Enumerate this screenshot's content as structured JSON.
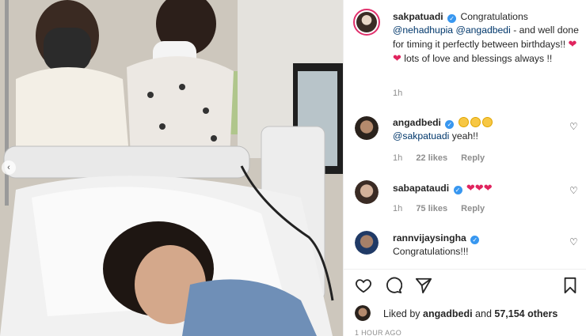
{
  "post": {
    "author": "sakpatuadi",
    "caption_parts": {
      "before": "Congratulations",
      "mention1": "@nehadhupia",
      "mention2": "@angadbedi",
      "after": "- and well done for timing it perfectly between birthdays!!",
      "end": "lots of love and blessings always !!"
    },
    "caption_time": "1h"
  },
  "comments": [
    {
      "user": "angadbedi",
      "mention": "@sakpatuadi",
      "text": "yeah!!",
      "time": "1h",
      "likes": "22 likes",
      "reply": "Reply"
    },
    {
      "user": "sabapataudi",
      "time": "1h",
      "likes": "75 likes",
      "reply": "Reply"
    },
    {
      "user": "rannvijaysingha",
      "text": "Congratulations!!!"
    }
  ],
  "likes_summary": {
    "prefix": "Liked by",
    "user": "angadbedi",
    "joiner": "and",
    "count": "57,154 others"
  },
  "timestamp": "1 HOUR AGO",
  "colors": {
    "verified": "#3897f0",
    "mention": "#00376b",
    "heart_emoji": "#e0245e",
    "story_ring": "#e1306c"
  },
  "icons": {
    "like": "heart-outline-icon",
    "comment": "comment-bubble-icon",
    "share": "paper-plane-icon",
    "save": "bookmark-icon"
  }
}
